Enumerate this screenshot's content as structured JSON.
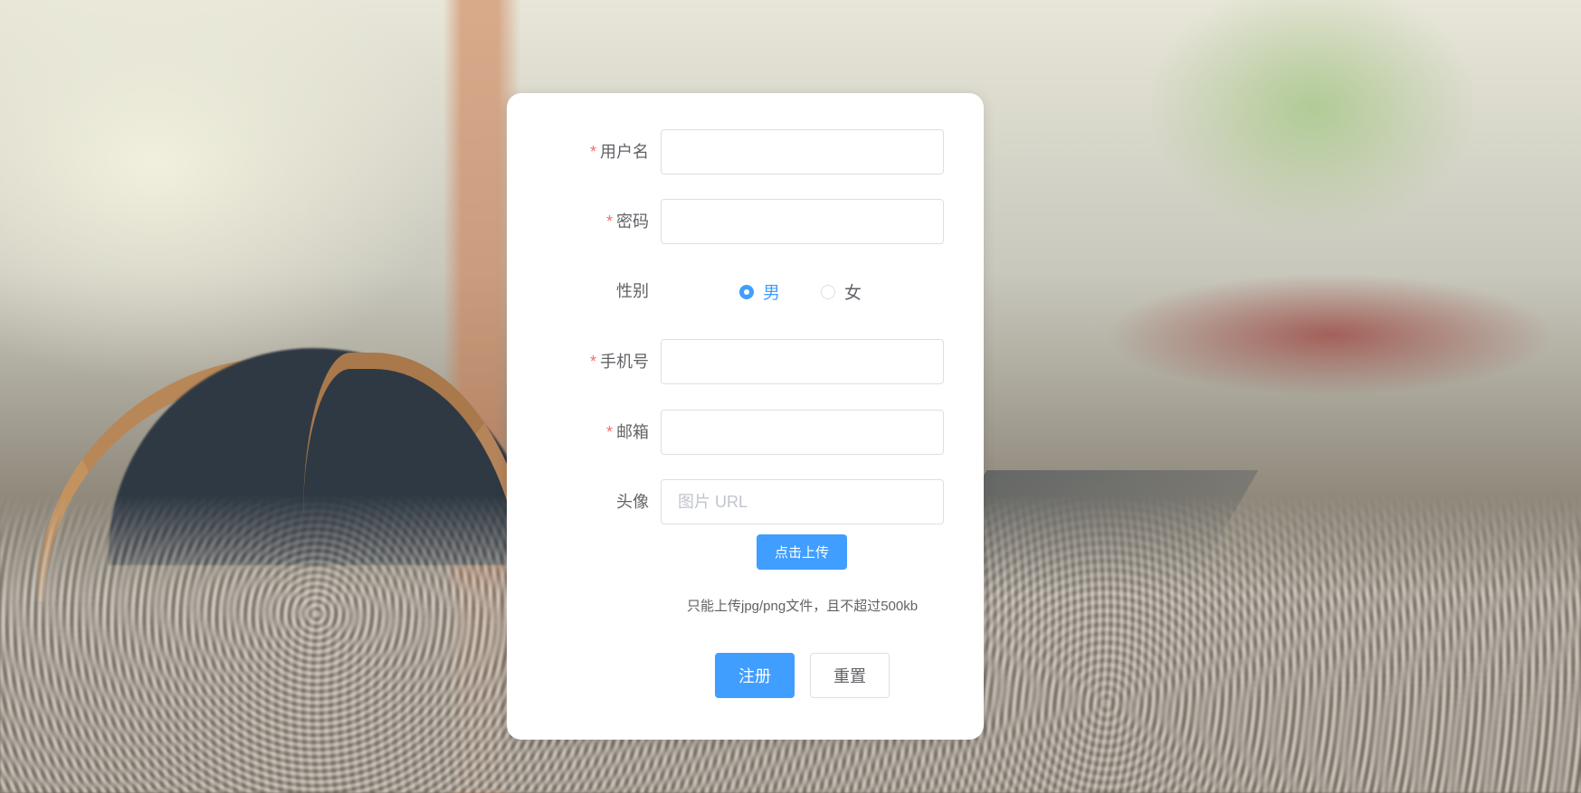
{
  "form": {
    "username": {
      "label": "用户名",
      "required": true,
      "value": ""
    },
    "password": {
      "label": "密码",
      "required": true,
      "value": ""
    },
    "gender": {
      "label": "性别",
      "options": [
        {
          "label": "男",
          "checked": true
        },
        {
          "label": "女",
          "checked": false
        }
      ]
    },
    "phone": {
      "label": "手机号",
      "required": true,
      "value": ""
    },
    "email": {
      "label": "邮箱",
      "required": true,
      "value": ""
    },
    "avatar": {
      "label": "头像",
      "placeholder": "图片 URL",
      "value": ""
    },
    "required_mark": "*",
    "upload_button": "点击上传",
    "upload_tip": "只能上传jpg/png文件，且不超过500kb",
    "submit_button": "注册",
    "reset_button": "重置"
  },
  "colors": {
    "primary": "#409eff",
    "required": "#f56c6c",
    "text": "#606266",
    "border": "#dcdfe6"
  }
}
